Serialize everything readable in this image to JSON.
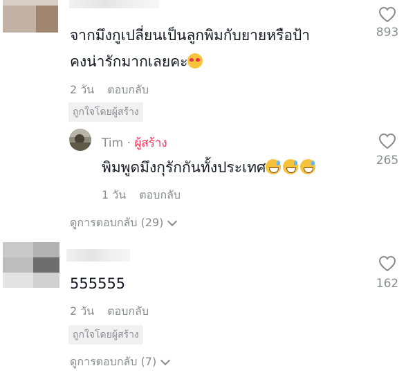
{
  "comments": [
    {
      "text_line1": "จากมึงกูเปลี่ยนเป็นลูกพิมกับยายหรือป้า",
      "text_line2": "คงน่ารักมากเลยคะ",
      "time": "2 วัน",
      "reply_label": "ตอบกลับ",
      "liked_by_creator": "ถูกใจโดยผู้สร้าง",
      "likes": "893",
      "view_replies": "ดูการตอบกลับ (29)",
      "reply": {
        "name": "Tim",
        "separator": "·",
        "creator_label": "ผู้สร้าง",
        "text": "พิมพูดมึงกุรักกันทั้งประเทศ",
        "time": "1 วัน",
        "reply_label": "ตอบกลับ",
        "likes": "265"
      }
    },
    {
      "text": "555555",
      "time": "2 วัน",
      "reply_label": "ตอบกลับ",
      "liked_by_creator": "ถูกใจโดยผู้สร้าง",
      "likes": "162",
      "view_replies": "ดูการตอบกลับ (7)"
    }
  ],
  "icons": {
    "like": "heart-icon",
    "expand": "chevron-down-icon",
    "emoji_love": "smiling-face-with-hearts-emoji",
    "emoji_sweat": "grinning-face-with-sweat-emoji"
  },
  "colors": {
    "creator": "#fe2c55",
    "muted": "#8a8b91",
    "text": "#161823"
  }
}
